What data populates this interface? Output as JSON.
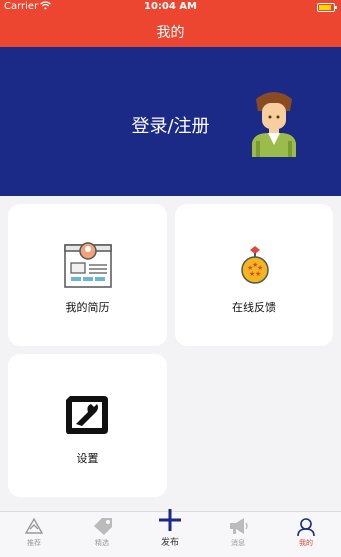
{
  "status_bar": {
    "carrier": "Carrier",
    "time": "10:04 AM"
  },
  "navbar": {
    "title": "我的"
  },
  "header": {
    "login_label": "登录/注册"
  },
  "cards": {
    "resume": "我的简历",
    "feedback": "在线反馈",
    "settings": "设置"
  },
  "tabbar": {
    "recommend": "推荐",
    "featured": "精选",
    "publish": "发布",
    "messages": "消息",
    "mine": "我的"
  },
  "colors": {
    "accent": "#ec4631",
    "banner": "#1a2a86",
    "active_tab": "#e24536"
  },
  "icons": [
    "wifi-icon",
    "battery-icon",
    "resume-icon",
    "feedback-icon",
    "settings-icon",
    "recommend-icon",
    "tag-icon",
    "plus-icon",
    "megaphone-icon",
    "person-icon"
  ]
}
